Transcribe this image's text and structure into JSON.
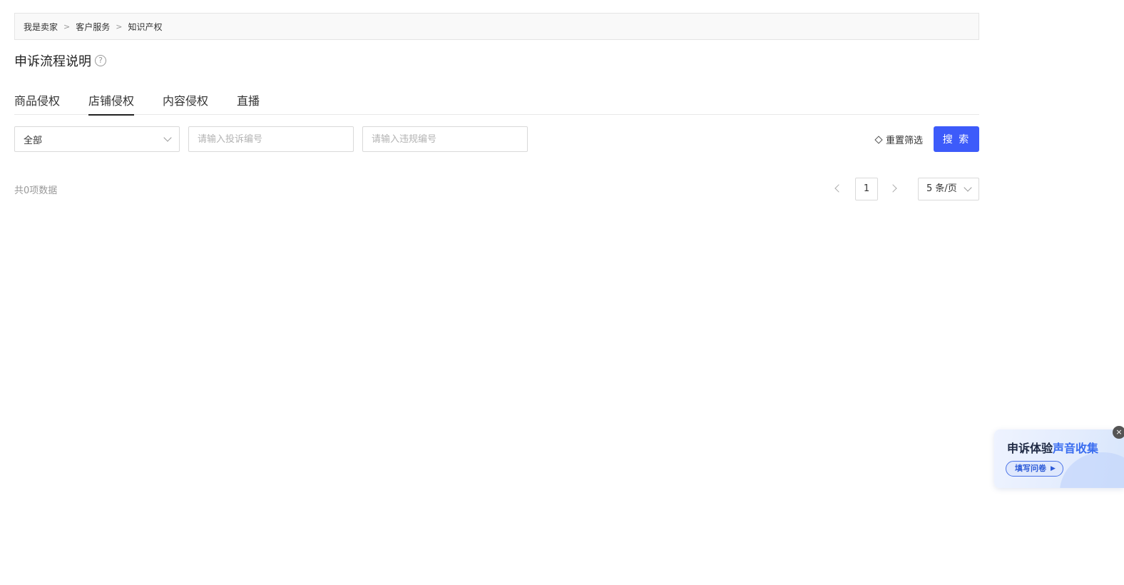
{
  "breadcrumb": {
    "items": [
      "我是卖家",
      "客户服务",
      "知识产权"
    ],
    "separator": ">"
  },
  "page": {
    "title": "申诉流程说明",
    "help_icon": "question-circle-icon"
  },
  "tabs": [
    {
      "label": "商品侵权",
      "active": false
    },
    {
      "label": "店铺侵权",
      "active": true
    },
    {
      "label": "内容侵权",
      "active": false
    },
    {
      "label": "直播",
      "active": false
    }
  ],
  "filters": {
    "status_select": {
      "value": "全部"
    },
    "complaint_input": {
      "value": "",
      "placeholder": "请输入投诉编号"
    },
    "violation_input": {
      "value": "",
      "placeholder": "请输入违规编号"
    },
    "reset_label": "重置筛选",
    "search_label": "搜 索"
  },
  "results": {
    "total_text": "共0项数据"
  },
  "pagination": {
    "current_page": "1",
    "page_size": "5 条/页"
  },
  "feedback_widget": {
    "title_part1": "申诉体验",
    "title_part2": "声音收集",
    "cta_label": "填写问卷",
    "close_glyph": "×"
  },
  "colors": {
    "primary": "#3d5bfa",
    "highlight": "#3a6df0"
  }
}
